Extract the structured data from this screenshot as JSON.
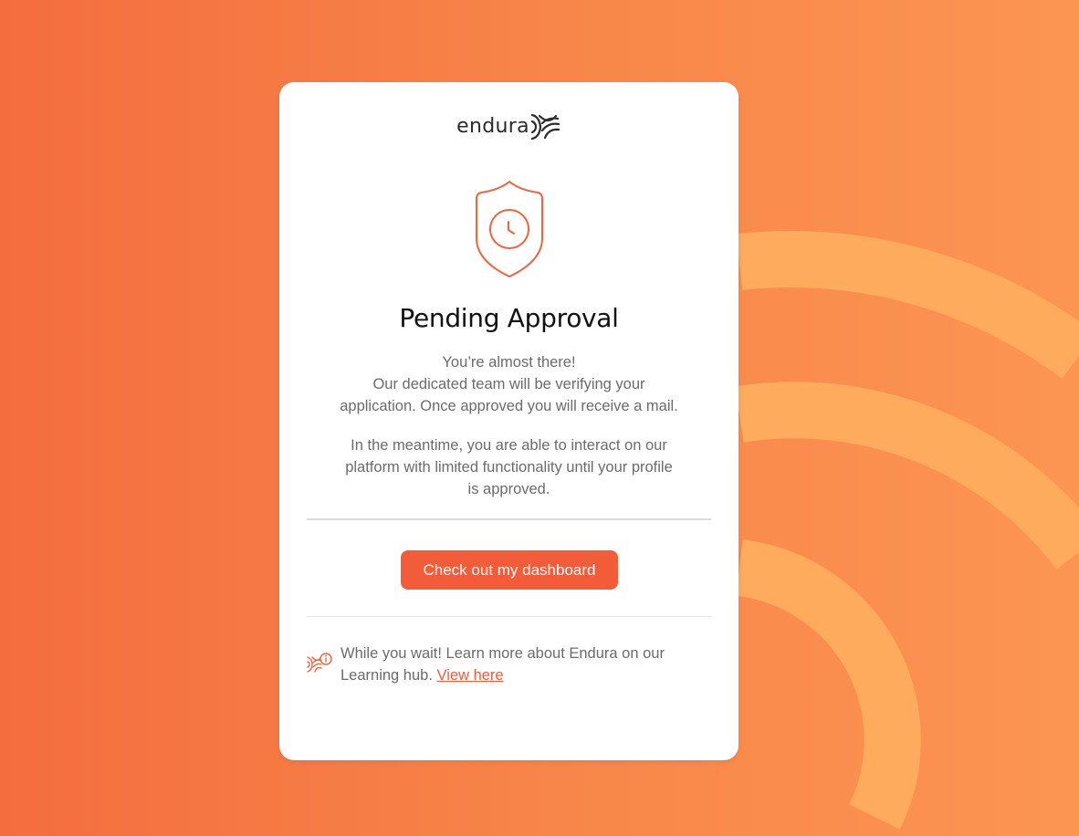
{
  "brand": {
    "name": "endura",
    "accent_color": "#f25c38",
    "background_color": "#f8874a",
    "arc_color": "#ffab5e"
  },
  "status": {
    "icon": "shield-clock-icon",
    "title": "Pending Approval"
  },
  "message": {
    "intro_lines": [
      "You’re almost there!",
      "Our dedicated team will be verifying your",
      "application. Once approved you will receive a mail."
    ],
    "meantime_lines": [
      "In the meantime, you are able to interact on our",
      "platform with limited functionality until your profile",
      "is approved."
    ]
  },
  "actions": {
    "dashboard_button": "Check out my dashboard"
  },
  "learning": {
    "icon": "endura-info-icon",
    "text": "While you wait! Learn more about Endura on our Learning hub. ",
    "link_label": "View here"
  }
}
